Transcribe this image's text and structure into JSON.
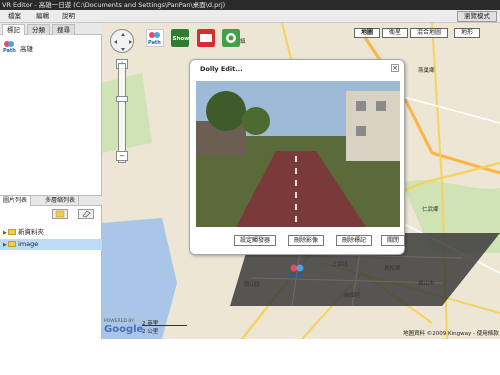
{
  "window": {
    "title": "VR Editor - 高雄一日遊 (C:\\Documents and Settings\\PanPan\\桌面\\d.prj)"
  },
  "menu": {
    "file": "檔案",
    "edit": "編輯",
    "help": "說明",
    "browse": "瀏覽模式"
  },
  "left_tabs": [
    "標記",
    "分類",
    "搜尋"
  ],
  "bookmark": {
    "label": "高雄"
  },
  "bottom_tabs": [
    "圖片列表",
    "多層縮列表"
  ],
  "tree": [
    {
      "label": "新資料夾",
      "selected": false
    },
    {
      "label": "image",
      "selected": true
    }
  ],
  "map_types": [
    "地圖",
    "衛星",
    "混合地圖",
    "地形"
  ],
  "plugins": [
    "path-icon",
    "show-icon",
    "photo-icon",
    "audio-icon"
  ],
  "popup": {
    "title": "Dolly Edit...",
    "buttons": [
      "設定觸發器",
      "刪除影像",
      "刪除標記",
      "關閉"
    ]
  },
  "map_labels": {
    "gangshan": "岡山鎮",
    "yanchao": "燕巢鄉",
    "gushan": "鼓山區",
    "sanmin": "三民區",
    "niaosong": "鳥松鄉",
    "fongshan": "鳳山市",
    "qianzhen": "前鎮區",
    "renwu": "仁武鄉"
  },
  "google": {
    "powered": "POWERED BY",
    "logo": "Google"
  },
  "scale": {
    "mile": "2 英里",
    "km": "2 公里"
  },
  "attribution": "地圖資料 ©2009 Kingway - 使用條款",
  "colors": {
    "map_bg": "#ede6d4",
    "road_yellow": "#f4d35e",
    "highway": "#ffb347",
    "selected": "#bcdcf6"
  }
}
